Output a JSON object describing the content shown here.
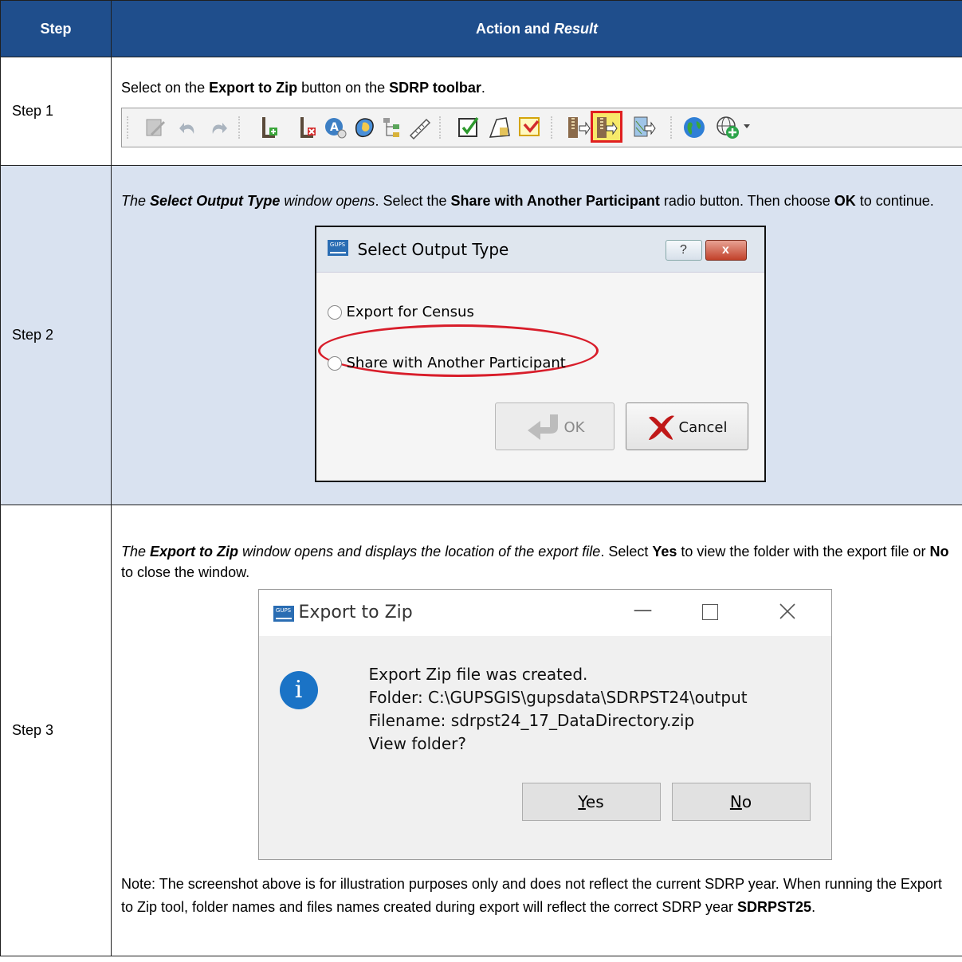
{
  "table": {
    "headers": {
      "step": "Step",
      "action_prefix": "Action and ",
      "action_italic": "Result"
    },
    "rows": [
      {
        "step": "Step 1",
        "text": {
          "a": "Select on the ",
          "b": "Export to Zip",
          "c": " button on the ",
          "d": "SDRP toolbar",
          "e": "."
        },
        "toolbar_icons": [
          "edit-icon",
          "undo-icon",
          "redo-icon",
          "add-feature-icon",
          "delete-feature-icon",
          "attribute-icon",
          "select-feature-icon",
          "tree-icon",
          "measure-icon",
          "review-icon",
          "polygon-icon",
          "save-edits-icon",
          "import-zip-icon",
          "export-zip-icon",
          "export-map-icon",
          "globe-icon",
          "add-service-icon"
        ]
      },
      {
        "step": "Step 2",
        "text": {
          "a": "The ",
          "b": "Select Output Type",
          "c": " window opens",
          "d": ". Select the ",
          "e": "Share with Another Participant",
          "f": " radio button. Then choose ",
          "g": "OK",
          "h": " to continue."
        },
        "dialog": {
          "app_icon": "GUPS",
          "title": "Select Output Type",
          "help": "?",
          "close": "x",
          "option1": "Export for Census",
          "option2": "Share with Another Participant",
          "ok": "OK",
          "cancel": "Cancel"
        }
      },
      {
        "step": "Step 3",
        "text": {
          "a": "The ",
          "b": "Export to Zip",
          "c": " window opens and displays the location of the export file",
          "d": ". Select ",
          "e": "Yes",
          "f": " to view the folder with the export file or ",
          "g": "No",
          "h": " to close the window."
        },
        "dialog": {
          "app_icon": "GUPS",
          "title": "Export to Zip",
          "message": [
            "Export Zip file was created.",
            "Folder: C:\\GUPSGIS\\gupsdata\\SDRPST24\\output",
            "Filename: sdrpst24_17_DataDirectory.zip",
            "View folder?"
          ],
          "yes_underline": "Y",
          "yes_rest": "es",
          "no_underline": "N",
          "no_rest": "o"
        },
        "note": {
          "text": "Note: The screenshot above is for illustration purposes only and does not reflect the current SDRP year. When running the Export to Zip tool, folder names and files names created during export will reflect the correct SDRP year ",
          "bold": "SDRPST25",
          "end": "."
        }
      }
    ]
  },
  "colors": {
    "header_bg": "#1f4e8c",
    "shaded_row": "#d9e2f0",
    "highlight_red": "#d81d2a"
  }
}
